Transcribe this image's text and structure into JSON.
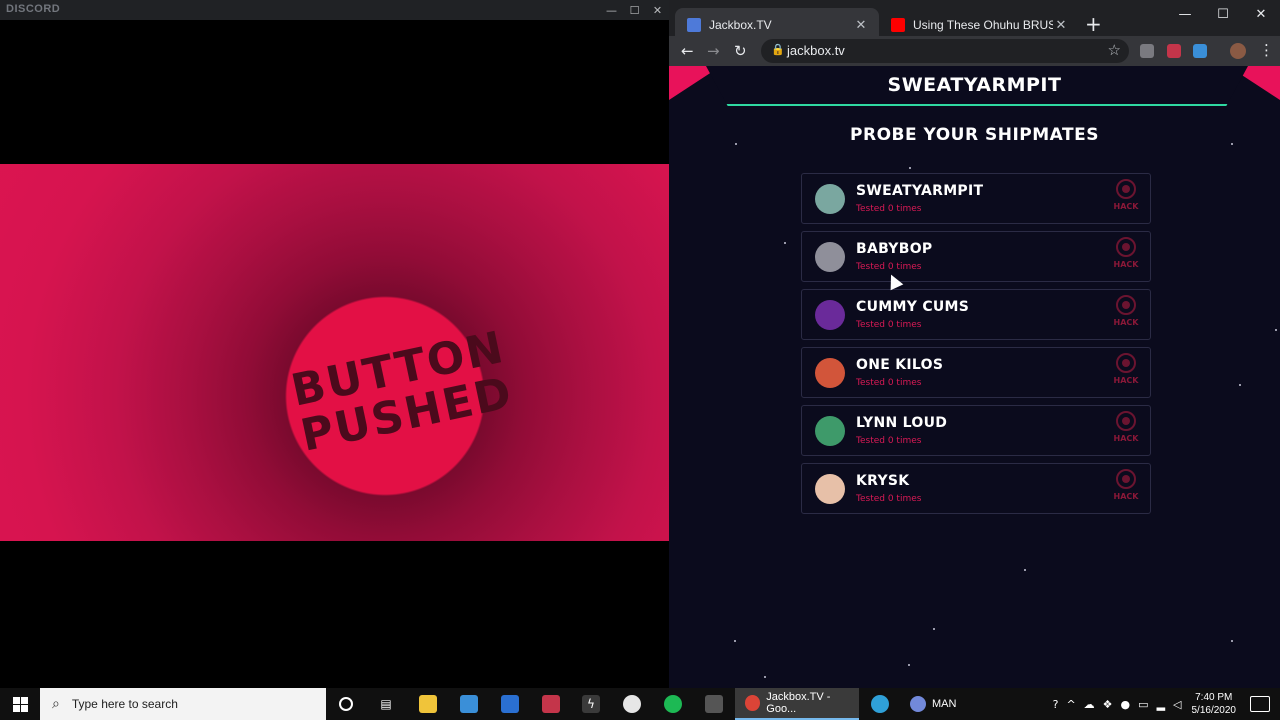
{
  "discord": {
    "title": "DISCORD",
    "controls": {
      "minimize": "—",
      "maximize": "☐",
      "close": "✕"
    },
    "stream_text": "BUTTON PUSHED"
  },
  "chrome": {
    "tabs": [
      {
        "title": "Jackbox.TV",
        "favicon_color": "#4e7ad9",
        "active": true
      },
      {
        "title": "Using These Ohuhu BRUSH MAR",
        "favicon_color": "#ff0000",
        "active": false
      }
    ],
    "tab_close": "✕",
    "new_tab": "+",
    "controls": {
      "minimize": "—",
      "maximize": "☐",
      "close": "✕"
    },
    "nav": {
      "back": "←",
      "forward": "→",
      "reload": "↻"
    },
    "url": "jackbox.tv",
    "star": "☆",
    "kebab": "⋮"
  },
  "game": {
    "player_name": "SWEATYARMPIT",
    "heading": "PROBE YOUR SHIPMATES",
    "hack_label": "HACK",
    "shipmates": [
      {
        "name": "SWEATYARMPIT",
        "subtitle": "Tested 0 times",
        "avatar_color": "#7aa7a0"
      },
      {
        "name": "BABYBOP",
        "subtitle": "Tested 0 times",
        "avatar_color": "#8f8f9a"
      },
      {
        "name": "CUMMY CUMS",
        "subtitle": "Tested 0 times",
        "avatar_color": "#6a2a9a"
      },
      {
        "name": "ONE KILOS",
        "subtitle": "Tested 0 times",
        "avatar_color": "#d2553a"
      },
      {
        "name": "LYNN LOUD",
        "subtitle": "Tested 0 times",
        "avatar_color": "#3e9a6a"
      },
      {
        "name": "KRYSK",
        "subtitle": "Tested 0 times",
        "avatar_color": "#e7c0a8"
      }
    ]
  },
  "taskbar": {
    "search_placeholder": "Type here to search",
    "apps": [
      {
        "label": "Jackbox.TV - Goo...",
        "active": true
      },
      {
        "label": "MAN",
        "active": false
      }
    ],
    "clock": {
      "time": "7:40 PM",
      "date": "5/16/2020"
    }
  }
}
